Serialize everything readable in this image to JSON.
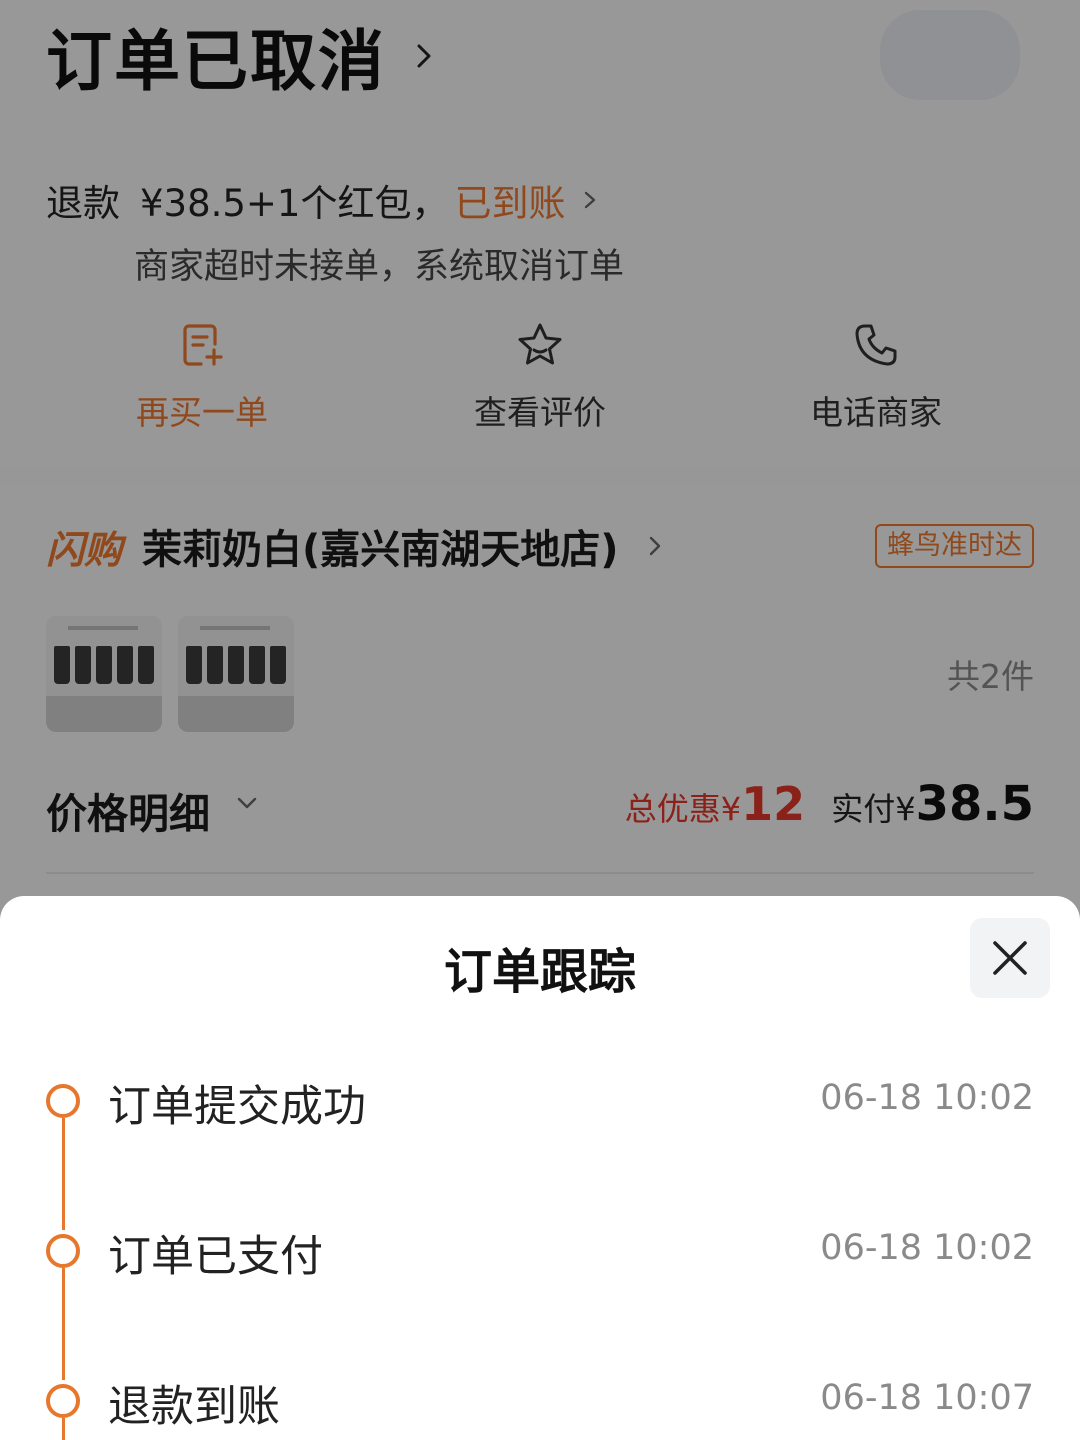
{
  "order": {
    "status_title": "订单已取消",
    "refund_label": "退款",
    "refund_amount": "¥38.5+1个红包，",
    "refund_status": "已到账",
    "cancel_reason": "商家超时未接单，系统取消订单"
  },
  "actions": [
    {
      "label": "再买一单",
      "icon": "reorder-icon"
    },
    {
      "label": "查看评价",
      "icon": "star-icon"
    },
    {
      "label": "电话商家",
      "icon": "phone-icon"
    }
  ],
  "shop": {
    "tag": "闪购",
    "name": "茉莉奶白(嘉兴南湖天地店)",
    "delivery_badge": "蜂鸟准时达",
    "item_count": "共2件"
  },
  "price": {
    "label": "价格明细",
    "discount_label": "总优惠¥",
    "discount_value": "12",
    "paid_label": "实付¥",
    "paid_value": "38.5"
  },
  "tracking": {
    "title": "订单跟踪",
    "events": [
      {
        "label": "订单提交成功",
        "time": "06-18 10:02"
      },
      {
        "label": "订单已支付",
        "time": "06-18 10:02"
      },
      {
        "label": "退款到账",
        "time": "06-18 10:07"
      }
    ]
  },
  "colors": {
    "accent": "#e8772e",
    "discount": "#e0382b"
  }
}
